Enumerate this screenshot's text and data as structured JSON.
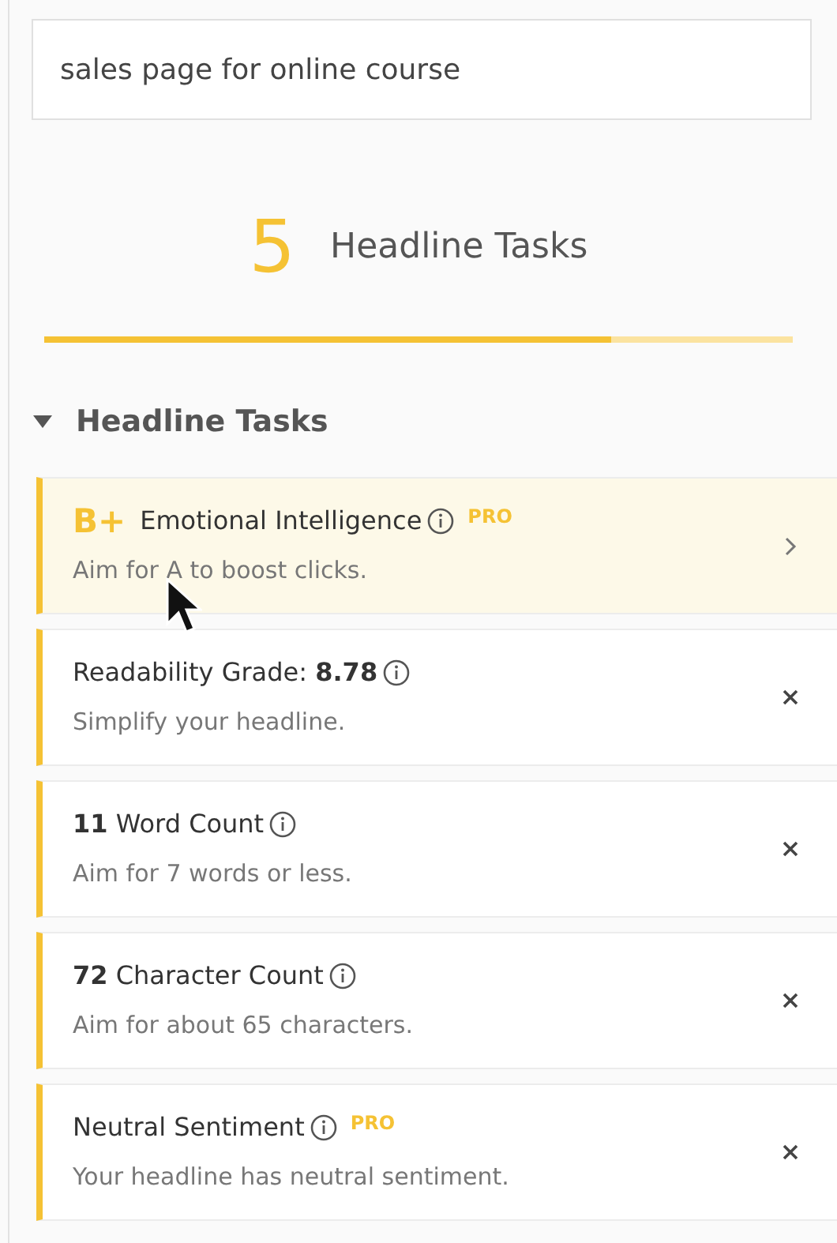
{
  "search": {
    "value": "sales page for online course"
  },
  "summary": {
    "count": "5",
    "label": "Headline Tasks",
    "level": 0.757
  },
  "section": {
    "title": "Headline Tasks",
    "expanded": true
  },
  "tasks": [
    {
      "grade": "B+",
      "title": "Emotional Intelligence",
      "pro": "PRO",
      "hint": "Aim for A to boost clicks.",
      "kind": "chevron",
      "selected": true
    },
    {
      "title": "Readability Grade: **8.78**",
      "hint": "Simplify your headline.",
      "kind": "close",
      "selected": false
    },
    {
      "title": "**11** Word Count",
      "hint": "Aim for 7 words or less.",
      "kind": "close",
      "selected": false
    },
    {
      "title": "**72** Character Count",
      "hint": "Aim for about 65 characters.",
      "kind": "close",
      "selected": false
    },
    {
      "title": "Neutral Sentiment",
      "pro": "PRO",
      "hint": "Your headline has neutral sentiment.",
      "kind": "close",
      "selected": false
    }
  ]
}
